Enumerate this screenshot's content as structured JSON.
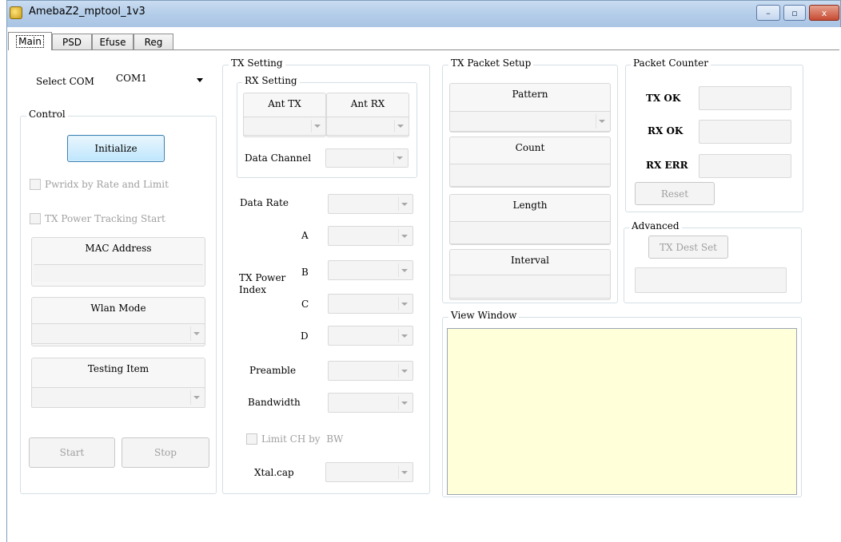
{
  "window": {
    "title": "AmebaZ2_mptool_1v3",
    "min": "–",
    "max": "▫",
    "close": "x"
  },
  "tabs": [
    "Main",
    "PSD",
    "Efuse",
    "Reg"
  ],
  "main": {
    "select_com_label": "Select COM",
    "select_com_value": "COM1",
    "control": {
      "title": "Control",
      "initialize": "Initialize",
      "pwridx": "Pwridx by Rate and Limit",
      "tx_power_tracking": "TX Power Tracking Start",
      "mac_address": "MAC Address",
      "wlan_mode": "Wlan Mode",
      "testing_item": "Testing Item",
      "start": "Start",
      "stop": "Stop"
    },
    "tx_setting": {
      "title": "TX Setting",
      "rx_setting": "RX Setting",
      "ant_tx": "Ant TX",
      "ant_rx": "Ant RX",
      "data_channel": "Data Channel",
      "data_rate": "Data Rate",
      "a": "A",
      "b": "B",
      "c": "C",
      "d": "D",
      "tx_power_index": "TX Power\nIndex",
      "preamble": "Preamble",
      "bandwidth": "Bandwidth",
      "limit_ch": "Limit CH by  BW",
      "xtal_cap": "Xtal.cap"
    },
    "tx_packet_setup": {
      "title": "TX Packet Setup",
      "pattern": "Pattern",
      "count": "Count",
      "length": "Length",
      "interval": "Interval"
    },
    "packet_counter": {
      "title": "Packet Counter",
      "tx_ok": "TX OK",
      "rx_ok": "RX OK",
      "rx_err": "RX ERR",
      "reset": "Reset"
    },
    "advanced": {
      "title": "Advanced",
      "tx_dest_set": "TX Dest Set"
    },
    "view_window": {
      "title": "View Window",
      "content": ""
    }
  },
  "colors": {
    "view_bg": "#ffffd9",
    "title_bar": "#b4cde9",
    "init_button": "#bee6fd"
  }
}
